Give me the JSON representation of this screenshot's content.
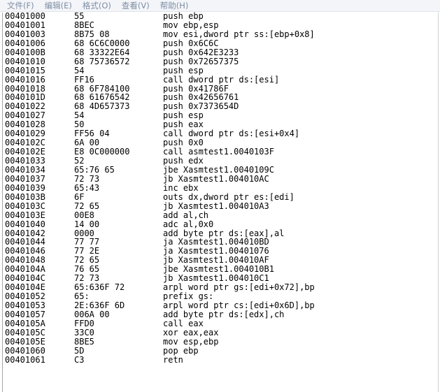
{
  "menu": [
    "文件(F)",
    "编辑(E)",
    "格式(O)",
    "查看(V)",
    "帮助(H)"
  ],
  "lines": [
    {
      "addr": "00401000",
      "hex": "55",
      "asm": "push ebp"
    },
    {
      "addr": "00401001",
      "hex": "8BEC",
      "asm": "mov ebp,esp"
    },
    {
      "addr": "00401003",
      "hex": "8B75 08",
      "asm": "mov esi,dword ptr ss:[ebp+0x8]"
    },
    {
      "addr": "00401006",
      "hex": "68 6C6C0000",
      "asm": "push 0x6C6C"
    },
    {
      "addr": "0040100B",
      "hex": "68 33322E64",
      "asm": "push 0x642E3233"
    },
    {
      "addr": "00401010",
      "hex": "68 75736572",
      "asm": "push 0x72657375"
    },
    {
      "addr": "00401015",
      "hex": "54",
      "asm": "push esp"
    },
    {
      "addr": "00401016",
      "hex": "FF16",
      "asm": "call dword ptr ds:[esi]"
    },
    {
      "addr": "00401018",
      "hex": "68 6F784100",
      "asm": "push 0x41786F"
    },
    {
      "addr": "0040101D",
      "hex": "68 61676542",
      "asm": "push 0x42656761"
    },
    {
      "addr": "00401022",
      "hex": "68 4D657373",
      "asm": "push 0x7373654D"
    },
    {
      "addr": "00401027",
      "hex": "54",
      "asm": "push esp"
    },
    {
      "addr": "00401028",
      "hex": "50",
      "asm": "push eax"
    },
    {
      "addr": "00401029",
      "hex": "FF56 04",
      "asm": "call dword ptr ds:[esi+0x4]"
    },
    {
      "addr": "0040102C",
      "hex": "6A 00",
      "asm": "push 0x0"
    },
    {
      "addr": "0040102E",
      "hex": "E8 0C000000",
      "asm": "call asmtest1.0040103F"
    },
    {
      "addr": "00401033",
      "hex": "52",
      "asm": "push edx"
    },
    {
      "addr": "00401034",
      "hex": "65:76 65",
      "asm": "jbe Xasmtest1.0040109C"
    },
    {
      "addr": "00401037",
      "hex": "72 73",
      "asm": "jb Xasmtest1.004010AC"
    },
    {
      "addr": "00401039",
      "hex": "65:43",
      "asm": "inc ebx"
    },
    {
      "addr": "0040103B",
      "hex": "6F",
      "asm": "outs dx,dword ptr es:[edi]"
    },
    {
      "addr": "0040103C",
      "hex": "72 65",
      "asm": "jb Xasmtest1.004010A3"
    },
    {
      "addr": "0040103E",
      "hex": "00E8",
      "asm": "add al,ch"
    },
    {
      "addr": "00401040",
      "hex": "14 00",
      "asm": "adc al,0x0"
    },
    {
      "addr": "00401042",
      "hex": "0000",
      "asm": "add byte ptr ds:[eax],al"
    },
    {
      "addr": "00401044",
      "hex": "77 77",
      "asm": "ja Xasmtest1.004010BD"
    },
    {
      "addr": "00401046",
      "hex": "77 2E",
      "asm": "ja Xasmtest1.00401076"
    },
    {
      "addr": "00401048",
      "hex": "72 65",
      "asm": "jb Xasmtest1.004010AF"
    },
    {
      "addr": "0040104A",
      "hex": "76 65",
      "asm": "jbe Xasmtest1.004010B1"
    },
    {
      "addr": "0040104C",
      "hex": "72 73",
      "asm": "jb Xasmtest1.004010C1"
    },
    {
      "addr": "0040104E",
      "hex": "65:636F 72",
      "asm": "arpl word ptr gs:[edi+0x72],bp"
    },
    {
      "addr": "00401052",
      "hex": "65:",
      "asm": "prefix gs:"
    },
    {
      "addr": "00401053",
      "hex": "2E:636F 6D",
      "asm": "arpl word ptr cs:[edi+0x6D],bp"
    },
    {
      "addr": "00401057",
      "hex": "006A 00",
      "asm": "add byte ptr ds:[edx],ch"
    },
    {
      "addr": "0040105A",
      "hex": "FFD0",
      "asm": "call eax"
    },
    {
      "addr": "0040105C",
      "hex": "33C0",
      "asm": "xor eax,eax"
    },
    {
      "addr": "0040105E",
      "hex": "8BE5",
      "asm": "mov esp,ebp"
    },
    {
      "addr": "00401060",
      "hex": "5D",
      "asm": "pop ebp"
    },
    {
      "addr": "00401061",
      "hex": "C3",
      "asm": "retn"
    }
  ]
}
